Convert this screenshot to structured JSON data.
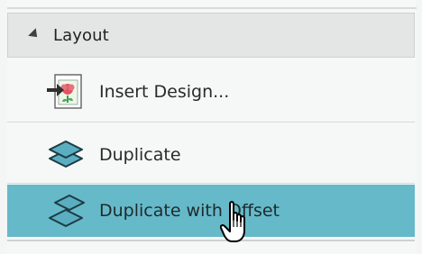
{
  "section": {
    "title": "Layout"
  },
  "items": [
    {
      "label": "Insert Design...",
      "icon": "insert-design-icon"
    },
    {
      "label": "Duplicate",
      "icon": "duplicate-icon"
    },
    {
      "label": "Duplicate with Offset",
      "icon": "duplicate-offset-icon",
      "highlighted": true
    }
  ],
  "colors": {
    "highlight": "#66b9c9",
    "header_bg": "#e4e5e5",
    "icon_teal": "#4d9fb1"
  }
}
